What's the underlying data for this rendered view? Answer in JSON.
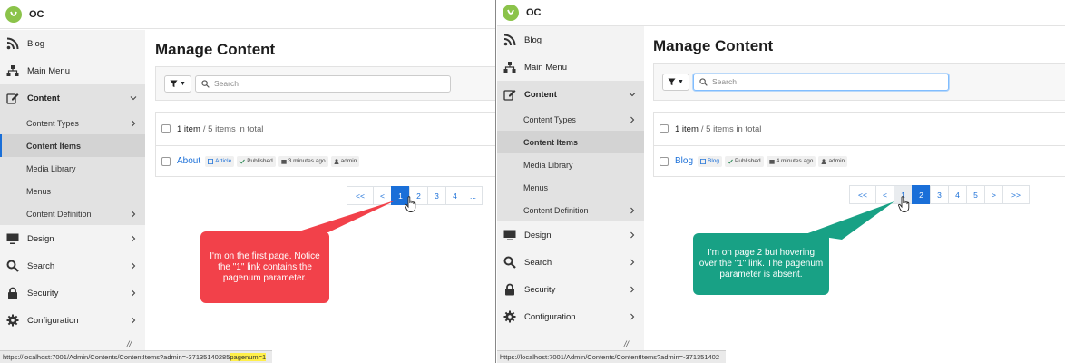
{
  "app": {
    "brand": "OC"
  },
  "sidebar": {
    "items": [
      {
        "label": "Blog",
        "icon": "rss-icon"
      },
      {
        "label": "Main Menu",
        "icon": "sitemap-icon"
      },
      {
        "label": "Content",
        "icon": "edit-icon"
      }
    ],
    "content_sub": [
      "Content Types",
      "Content Items",
      "Media Library",
      "Menus",
      "Content Definition"
    ],
    "items_bottom": [
      {
        "label": "Design",
        "icon": "monitor-icon"
      },
      {
        "label": "Search",
        "icon": "search-icon"
      },
      {
        "label": "Security",
        "icon": "lock-icon"
      },
      {
        "label": "Configuration",
        "icon": "gear-icon"
      }
    ],
    "collapse": "//"
  },
  "main": {
    "title": "Manage Content",
    "filter_caret": "▼",
    "search_placeholder": "Search",
    "count_label": "1 item",
    "total_label": "/ 5 items in total"
  },
  "left": {
    "row": {
      "title": "About",
      "type": "Article",
      "status": "Published",
      "modified": "3 minutes ago",
      "author": "admin"
    },
    "pager": [
      "<<",
      "<",
      "1",
      "2",
      "3",
      "4",
      "..."
    ],
    "active_page": "1",
    "callout": "I'm on the first page. Notice the \"1\" link contains the pagenum parameter.",
    "status_url": "https://localhost:7001/Admin/Contents/ContentItems?admin=-37135140285",
    "status_highlight": "pagenum=1"
  },
  "right": {
    "row": {
      "title": "Blog",
      "type": "Blog",
      "status": "Published",
      "modified": "4 minutes ago",
      "author": "admin"
    },
    "pager": [
      "<<",
      "<",
      "1",
      "2",
      "3",
      "4",
      "5",
      ">",
      ">>"
    ],
    "active_page": "2",
    "hover_page": "1",
    "callout": "I'm on page 2 but hovering over the \"1\" link. The pagenum parameter is absent.",
    "status_url": "https://localhost:7001/Admin/Contents/ContentItems?admin=-371351402"
  },
  "colors": {
    "accent": "#1a6fd8",
    "callout_red": "#f2414a",
    "callout_green": "#18a185",
    "highlight": "#ffef4a",
    "logo": "#8bc34a"
  }
}
